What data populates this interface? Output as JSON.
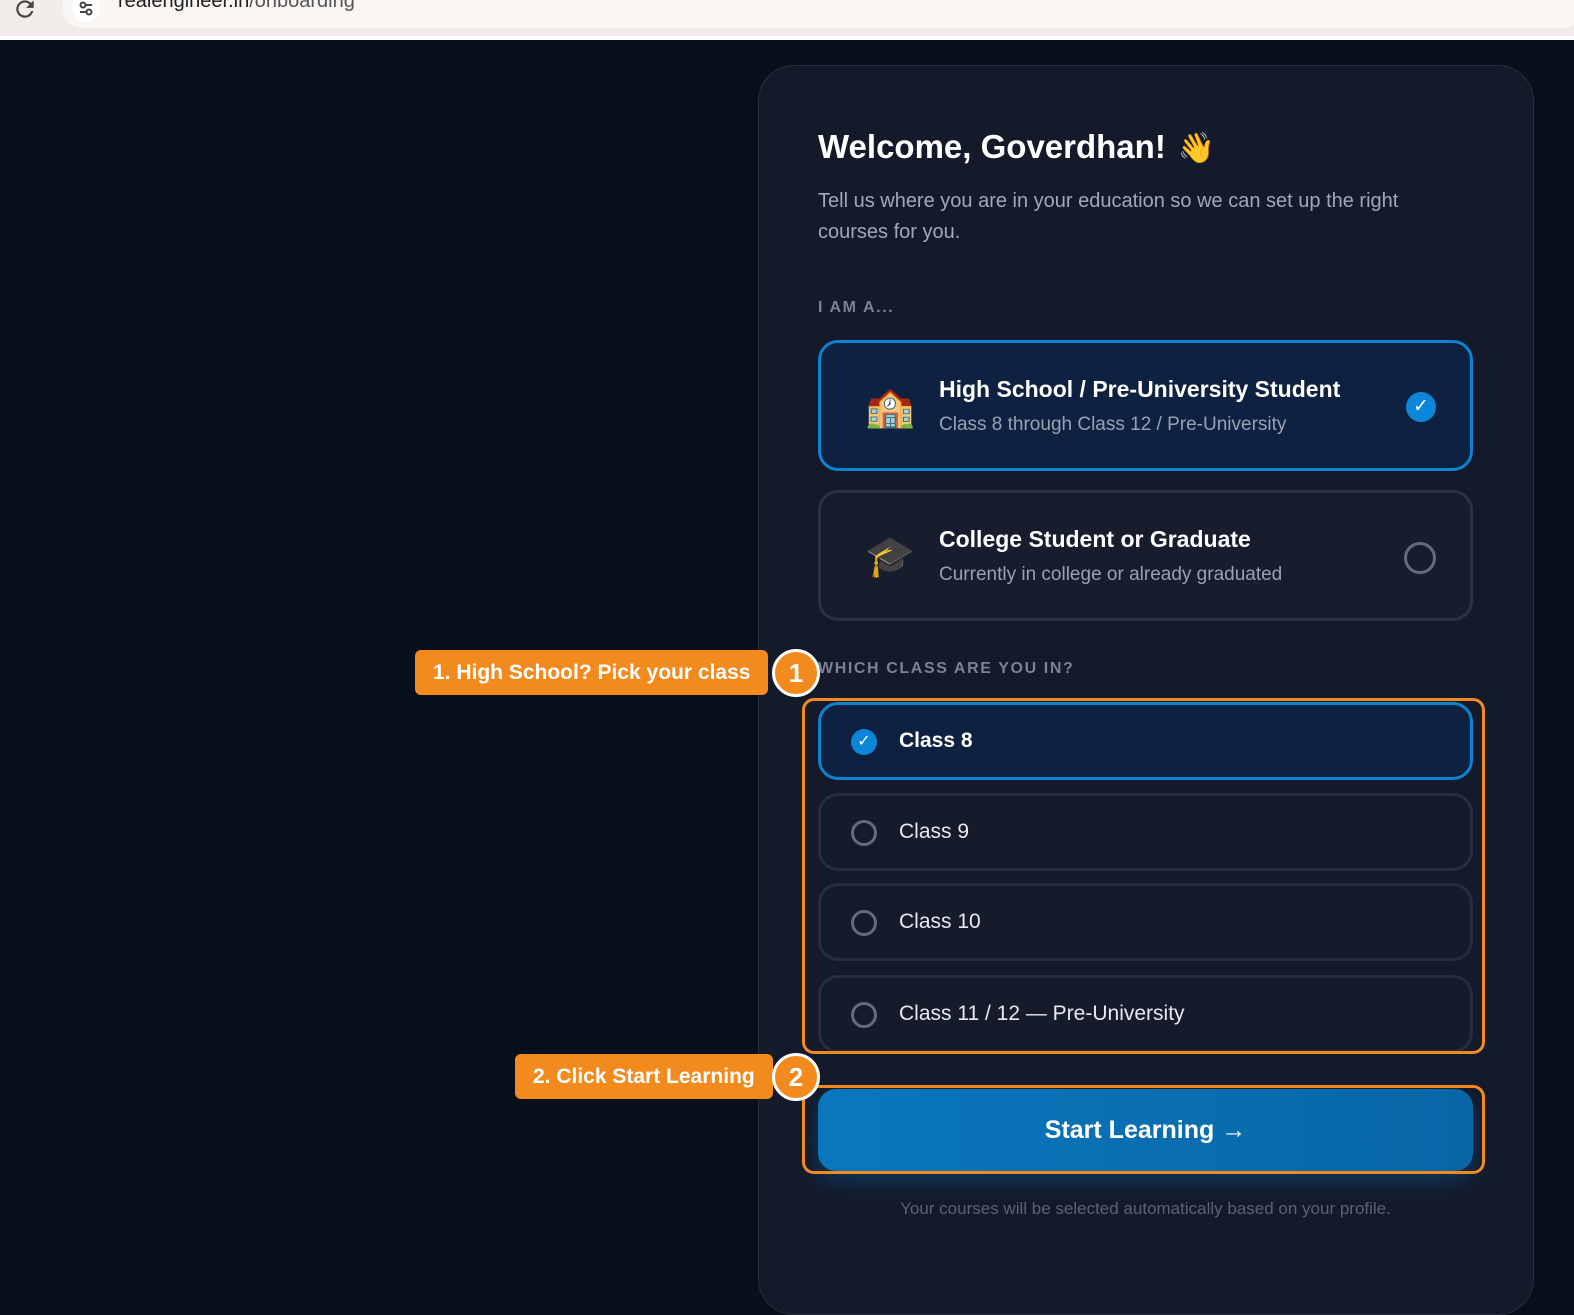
{
  "browser": {
    "url_host": "realengineer.in",
    "url_path": "/onboarding"
  },
  "header": {
    "title": "Welcome, Goverdhan!",
    "wave_emoji": "👋",
    "subtitle": "Tell us where you are in your education so we can set up the right courses for you."
  },
  "role_section": {
    "label": "I AM A...",
    "options": [
      {
        "emoji": "🏫",
        "title": "High School / Pre-University Student",
        "subtitle": "Class 8 through Class 12 / Pre-University",
        "selected": true,
        "check": "✓"
      },
      {
        "emoji": "🎓",
        "title": "College Student or Graduate",
        "subtitle": "Currently in college or already graduated",
        "selected": false
      }
    ]
  },
  "class_section": {
    "label": "WHICH CLASS ARE YOU IN?",
    "options": [
      {
        "label": "Class 8",
        "selected": true,
        "check": "✓"
      },
      {
        "label": "Class 9",
        "selected": false
      },
      {
        "label": "Class 10",
        "selected": false
      },
      {
        "label": "Class 11 / 12 — Pre-University",
        "selected": false
      }
    ]
  },
  "start_button": {
    "label": "Start Learning →"
  },
  "footnote": "Your courses will be selected automatically based on your profile.",
  "annotations": [
    {
      "text": "1. High School? Pick your class",
      "number": "1"
    },
    {
      "text": "2. Click Start Learning",
      "number": "2"
    }
  ],
  "colors": {
    "background": "#0a0f1c",
    "card": "#141a2a",
    "accent": "#0c86d8",
    "annotation": "#f28a1e"
  },
  "icons": {
    "reload": "reload-icon",
    "site_settings": "tune-icon",
    "check": "check-icon",
    "radio": "radio-icon"
  }
}
